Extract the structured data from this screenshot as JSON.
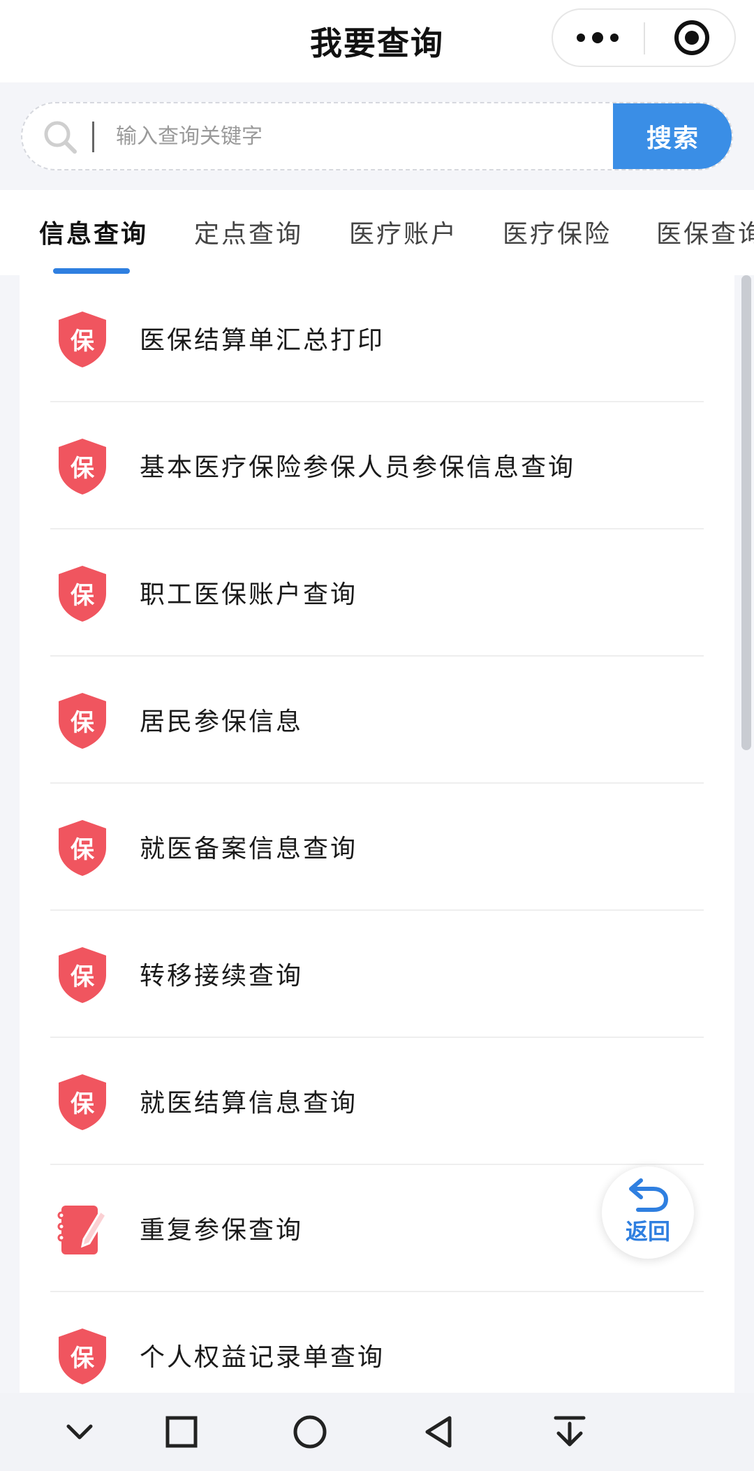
{
  "app": {
    "title": "我要查询"
  },
  "capsule": {
    "more_icon": "more-dots-icon",
    "close_icon": "target-circle-icon"
  },
  "search": {
    "placeholder": "输入查询关键字",
    "button_label": "搜索",
    "icon": "search-icon"
  },
  "tabs": [
    {
      "label": "信息查询",
      "active": true
    },
    {
      "label": "定点查询",
      "active": false
    },
    {
      "label": "医疗账户",
      "active": false
    },
    {
      "label": "医疗保险",
      "active": false
    },
    {
      "label": "医保查询",
      "active": false
    }
  ],
  "list": {
    "items": [
      {
        "label": "医保结算单汇总打印",
        "icon": "insurance-shield-icon"
      },
      {
        "label": "基本医疗保险参保人员参保信息查询",
        "icon": "insurance-shield-icon"
      },
      {
        "label": "职工医保账户查询",
        "icon": "insurance-shield-icon"
      },
      {
        "label": "居民参保信息",
        "icon": "insurance-shield-icon"
      },
      {
        "label": "就医备案信息查询",
        "icon": "insurance-shield-icon"
      },
      {
        "label": "转移接续查询",
        "icon": "insurance-shield-icon"
      },
      {
        "label": "就医结算信息查询",
        "icon": "insurance-shield-icon"
      },
      {
        "label": "重复参保查询",
        "icon": "notebook-pen-icon"
      },
      {
        "label": "个人权益记录单查询",
        "icon": "insurance-shield-icon"
      }
    ],
    "shield_char": "保"
  },
  "back_button": {
    "label": "返回",
    "icon": "return-arrow-icon"
  },
  "colors": {
    "accent_blue": "#3a8ee6",
    "icon_red": "#f0555f",
    "tab_indicator": "#2f7fe0"
  },
  "navbar": {
    "buttons": [
      "chevron-down-icon",
      "square-recents-icon",
      "circle-home-icon",
      "triangle-back-icon",
      "download-arrow-icon"
    ]
  }
}
